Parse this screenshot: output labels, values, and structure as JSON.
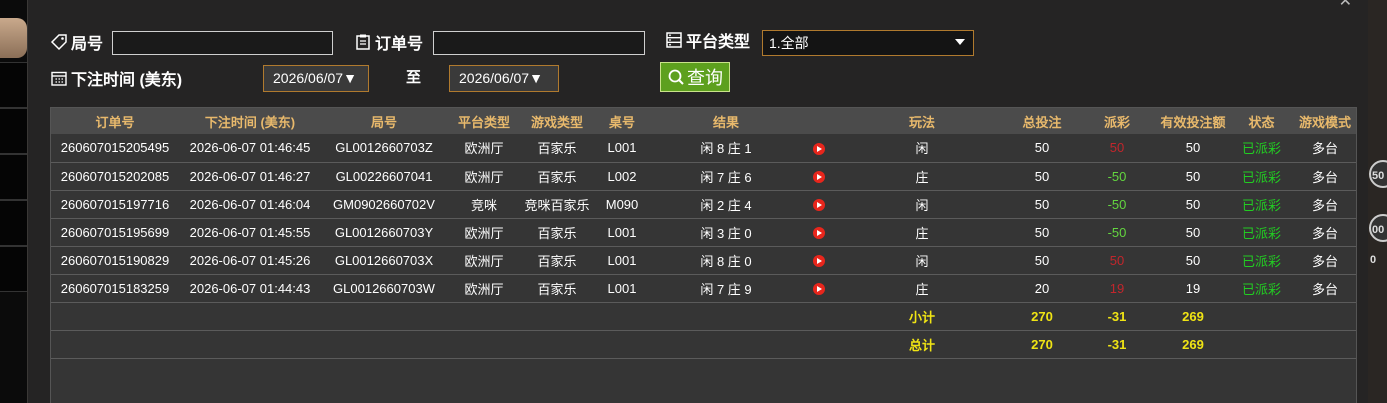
{
  "filters": {
    "round_label": "局号",
    "round_value": "",
    "order_label": "订单号",
    "order_value": "",
    "platform_label": "平台类型",
    "platform_selected": "1.全部",
    "bet_time_label": "下注时间 (美东)",
    "date_from": "2026/06/07▼",
    "to_label": "至",
    "date_to": "2026/06/07▼",
    "query_button": "查询"
  },
  "table": {
    "headers": [
      "订单号",
      "下注时间 (美东)",
      "局号",
      "平台类型",
      "游戏类型",
      "桌号",
      "结果",
      "",
      "玩法",
      "总投注",
      "派彩",
      "有效投注额",
      "状态",
      "游戏模式"
    ],
    "rows": [
      {
        "order": "260607015205495",
        "time": "2026-06-07 01:46:45",
        "round": "GL0012660703Z",
        "platform": "欧洲厅",
        "game": "百家乐",
        "table": "L001",
        "result": "闲 8 庄 1",
        "play": "闲",
        "bet": "50",
        "payout": "50",
        "payout_color": "red",
        "valid": "50",
        "status": "已派彩",
        "mode": "多台"
      },
      {
        "order": "260607015202085",
        "time": "2026-06-07 01:46:27",
        "round": "GL00226607041",
        "platform": "欧洲厅",
        "game": "百家乐",
        "table": "L002",
        "result": "闲 7 庄 6",
        "play": "庄",
        "bet": "50",
        "payout": "-50",
        "payout_color": "green",
        "valid": "50",
        "status": "已派彩",
        "mode": "多台"
      },
      {
        "order": "260607015197716",
        "time": "2026-06-07 01:46:04",
        "round": "GM0902660702V",
        "platform": "竞咪",
        "game": "竞咪百家乐",
        "table": "M090",
        "result": "闲 2 庄 4",
        "play": "闲",
        "bet": "50",
        "payout": "-50",
        "payout_color": "green",
        "valid": "50",
        "status": "已派彩",
        "mode": "多台"
      },
      {
        "order": "260607015195699",
        "time": "2026-06-07 01:45:55",
        "round": "GL0012660703Y",
        "platform": "欧洲厅",
        "game": "百家乐",
        "table": "L001",
        "result": "闲 3 庄 0",
        "play": "庄",
        "bet": "50",
        "payout": "-50",
        "payout_color": "green",
        "valid": "50",
        "status": "已派彩",
        "mode": "多台"
      },
      {
        "order": "260607015190829",
        "time": "2026-06-07 01:45:26",
        "round": "GL0012660703X",
        "platform": "欧洲厅",
        "game": "百家乐",
        "table": "L001",
        "result": "闲 8 庄 0",
        "play": "闲",
        "bet": "50",
        "payout": "50",
        "payout_color": "red",
        "valid": "50",
        "status": "已派彩",
        "mode": "多台"
      },
      {
        "order": "260607015183259",
        "time": "2026-06-07 01:44:43",
        "round": "GL0012660703W",
        "platform": "欧洲厅",
        "game": "百家乐",
        "table": "L001",
        "result": "闲 7 庄 9",
        "play": "庄",
        "bet": "20",
        "payout": "19",
        "payout_color": "red",
        "valid": "19",
        "status": "已派彩",
        "mode": "多台"
      }
    ],
    "subtotal": {
      "label": "小计",
      "bet": "270",
      "payout": "-31",
      "valid": "269"
    },
    "total": {
      "label": "总计",
      "bet": "270",
      "payout": "-31",
      "valid": "269"
    }
  },
  "background": {
    "chips": [
      "50",
      "00",
      "0"
    ]
  },
  "icons": {
    "round": "tag-icon",
    "order": "clipboard-icon",
    "platform": "server-icon",
    "time": "calendar-icon",
    "query": "search-icon",
    "result_replay": "play-icon"
  },
  "colors": {
    "header_text": "#e8b96c",
    "payout_positive": "#c2262c",
    "payout_negative": "#63d63f",
    "status": "#22cc22",
    "sum_text": "#f0e414",
    "query_button": "#5da01e",
    "select_border": "#b07a2e"
  }
}
